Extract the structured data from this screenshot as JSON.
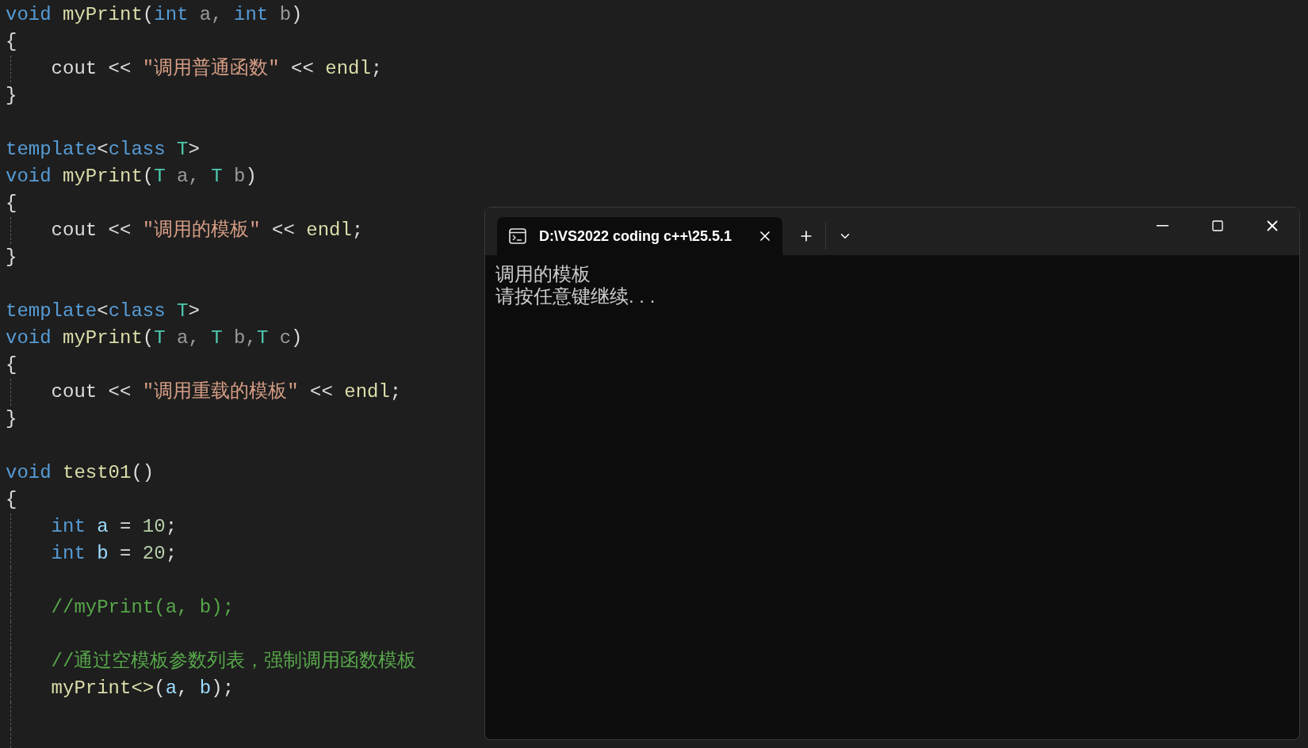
{
  "editor": {
    "lines": [
      {
        "guide": false,
        "tokens": [
          {
            "text": "void",
            "kind": "keyword"
          },
          {
            "text": " myPrint",
            "kind": "function"
          },
          {
            "text": "(",
            "kind": "plain"
          },
          {
            "text": "int",
            "kind": "keyword"
          },
          {
            "text": " a, ",
            "kind": "param"
          },
          {
            "text": "int",
            "kind": "keyword"
          },
          {
            "text": " b",
            "kind": "param"
          },
          {
            "text": ")",
            "kind": "plain"
          }
        ]
      },
      {
        "guide": false,
        "tokens": [
          {
            "text": "{",
            "kind": "plain"
          }
        ]
      },
      {
        "guide": true,
        "tokens": [
          {
            "text": "    cout << ",
            "kind": "plain"
          },
          {
            "text": "\"调用普通函数\"",
            "kind": "string"
          },
          {
            "text": " << ",
            "kind": "plain"
          },
          {
            "text": "endl",
            "kind": "function"
          },
          {
            "text": ";",
            "kind": "plain"
          }
        ]
      },
      {
        "guide": false,
        "tokens": [
          {
            "text": "}",
            "kind": "plain"
          }
        ]
      },
      {
        "guide": false
      },
      {
        "guide": false,
        "tokens": [
          {
            "text": "template",
            "kind": "keyword"
          },
          {
            "text": "<",
            "kind": "plain"
          },
          {
            "text": "class",
            "kind": "keyword"
          },
          {
            "text": " T",
            "kind": "type"
          },
          {
            "text": ">",
            "kind": "plain"
          }
        ]
      },
      {
        "guide": false,
        "tokens": [
          {
            "text": "void",
            "kind": "keyword"
          },
          {
            "text": " myPrint",
            "kind": "function"
          },
          {
            "text": "(",
            "kind": "plain"
          },
          {
            "text": "T",
            "kind": "type"
          },
          {
            "text": " a, ",
            "kind": "param"
          },
          {
            "text": "T",
            "kind": "type"
          },
          {
            "text": " b",
            "kind": "param"
          },
          {
            "text": ")",
            "kind": "plain"
          }
        ]
      },
      {
        "guide": false,
        "tokens": [
          {
            "text": "{",
            "kind": "plain"
          }
        ]
      },
      {
        "guide": true,
        "tokens": [
          {
            "text": "    cout << ",
            "kind": "plain"
          },
          {
            "text": "\"调用的模板\"",
            "kind": "string"
          },
          {
            "text": " << ",
            "kind": "plain"
          },
          {
            "text": "endl",
            "kind": "function"
          },
          {
            "text": ";",
            "kind": "plain"
          }
        ]
      },
      {
        "guide": false,
        "tokens": [
          {
            "text": "}",
            "kind": "plain"
          }
        ]
      },
      {
        "guide": false
      },
      {
        "guide": false,
        "tokens": [
          {
            "text": "template",
            "kind": "keyword"
          },
          {
            "text": "<",
            "kind": "plain"
          },
          {
            "text": "class",
            "kind": "keyword"
          },
          {
            "text": " T",
            "kind": "type"
          },
          {
            "text": ">",
            "kind": "plain"
          }
        ]
      },
      {
        "guide": false,
        "tokens": [
          {
            "text": "void",
            "kind": "keyword"
          },
          {
            "text": " myPrint",
            "kind": "function"
          },
          {
            "text": "(",
            "kind": "plain"
          },
          {
            "text": "T",
            "kind": "type"
          },
          {
            "text": " a, ",
            "kind": "param"
          },
          {
            "text": "T",
            "kind": "type"
          },
          {
            "text": " b,",
            "kind": "param"
          },
          {
            "text": "T",
            "kind": "type"
          },
          {
            "text": " c",
            "kind": "param"
          },
          {
            "text": ")",
            "kind": "plain"
          }
        ]
      },
      {
        "guide": false,
        "tokens": [
          {
            "text": "{",
            "kind": "plain"
          }
        ]
      },
      {
        "guide": true,
        "tokens": [
          {
            "text": "    cout << ",
            "kind": "plain"
          },
          {
            "text": "\"调用重载的模板\"",
            "kind": "string"
          },
          {
            "text": " << ",
            "kind": "plain"
          },
          {
            "text": "endl",
            "kind": "function"
          },
          {
            "text": ";",
            "kind": "plain"
          }
        ]
      },
      {
        "guide": false,
        "tokens": [
          {
            "text": "}",
            "kind": "plain"
          }
        ]
      },
      {
        "guide": false
      },
      {
        "guide": false,
        "tokens": [
          {
            "text": "void",
            "kind": "keyword"
          },
          {
            "text": " test01",
            "kind": "function"
          },
          {
            "text": "()",
            "kind": "plain"
          }
        ]
      },
      {
        "guide": false,
        "tokens": [
          {
            "text": "{",
            "kind": "plain"
          }
        ]
      },
      {
        "guide": true,
        "tokens": [
          {
            "text": "    int",
            "kind": "keyword"
          },
          {
            "text": " a",
            "kind": "local"
          },
          {
            "text": " = ",
            "kind": "plain"
          },
          {
            "text": "10",
            "kind": "number"
          },
          {
            "text": ";",
            "kind": "plain"
          }
        ]
      },
      {
        "guide": true,
        "tokens": [
          {
            "text": "    int",
            "kind": "keyword"
          },
          {
            "text": " b",
            "kind": "local"
          },
          {
            "text": " = ",
            "kind": "plain"
          },
          {
            "text": "20",
            "kind": "number"
          },
          {
            "text": ";",
            "kind": "plain"
          }
        ]
      },
      {
        "guide": true
      },
      {
        "guide": true,
        "tokens": [
          {
            "text": "    //myPrint(a, b);",
            "kind": "comment"
          }
        ]
      },
      {
        "guide": true
      },
      {
        "guide": true,
        "tokens": [
          {
            "text": "    //通过空模板参数列表，强制调用函数模板",
            "kind": "comment"
          }
        ]
      },
      {
        "guide": true,
        "tokens": [
          {
            "text": "    myPrint<>",
            "kind": "function"
          },
          {
            "text": "(",
            "kind": "plain"
          },
          {
            "text": "a",
            "kind": "local"
          },
          {
            "text": ", ",
            "kind": "plain"
          },
          {
            "text": "b",
            "kind": "local"
          },
          {
            "text": ");",
            "kind": "plain"
          }
        ]
      },
      {
        "guide": true
      },
      {
        "guide": true
      }
    ]
  },
  "terminal": {
    "tab_title": "D:\\VS2022 coding c++\\25.5.1",
    "output": [
      "调用的模板",
      "请按任意键继续. . ."
    ]
  }
}
